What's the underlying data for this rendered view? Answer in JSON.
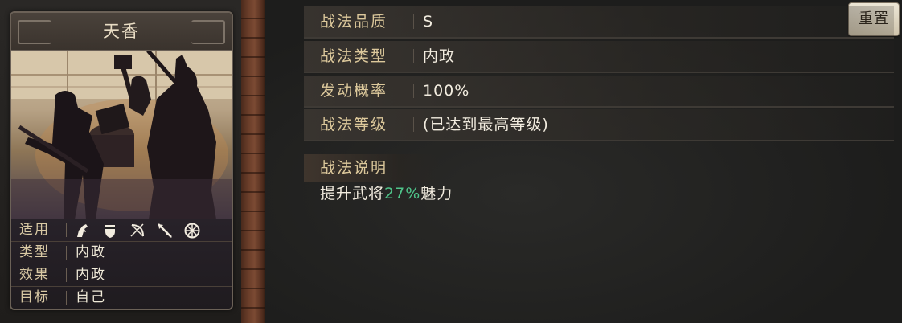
{
  "card": {
    "name": "天香",
    "info": [
      {
        "key": "适用",
        "icons": [
          "cavalry-icon",
          "shield-icon",
          "bow-icon",
          "spear-icon",
          "wheel-icon"
        ]
      },
      {
        "key": "类型",
        "value": "内政"
      },
      {
        "key": "效果",
        "value": "内政"
      },
      {
        "key": "目标",
        "value": "自己"
      }
    ]
  },
  "reset_button": {
    "label": "重置"
  },
  "attributes": [
    {
      "key": "战法品质",
      "value": "S"
    },
    {
      "key": "战法类型",
      "value": "内政"
    },
    {
      "key": "发动概率",
      "value": "100%"
    },
    {
      "key": "战法等级",
      "value": "(已达到最高等级)"
    }
  ],
  "description": {
    "label": "战法说明",
    "prefix": "提升武将",
    "highlight": "27%",
    "suffix": "魅力",
    "highlight_color": "#4fc48a"
  }
}
